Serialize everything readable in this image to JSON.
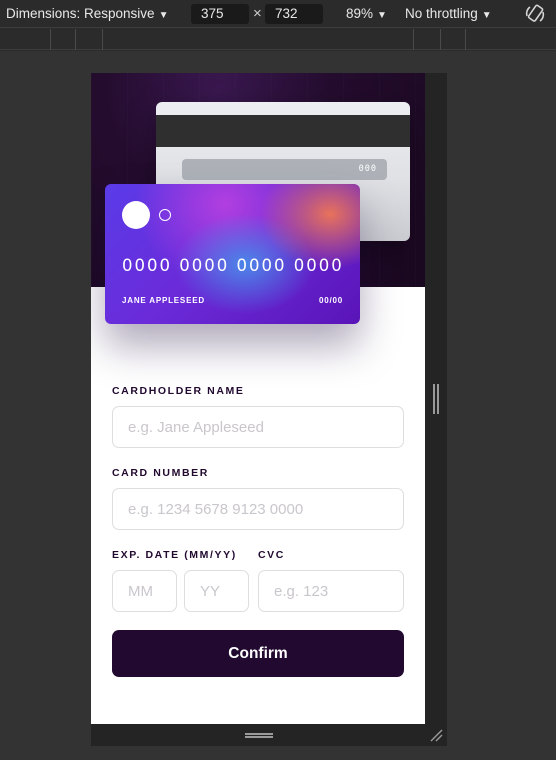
{
  "devtools": {
    "dimensions_label": "Dimensions: Responsive",
    "width_value": "375",
    "height_value": "732",
    "times_symbol": "×",
    "zoom_label": "89%",
    "throttling_label": "No throttling",
    "caret_glyph": "▼",
    "icons": {
      "dropdown": "chevron-down-icon",
      "rotate": "rotate-icon",
      "resize": "resize-grip-icon"
    }
  },
  "card_back": {
    "cvc": "000"
  },
  "card_front": {
    "number": "0000 0000 0000 0000",
    "name": "JANE APPLESEED",
    "expiry": "00/00"
  },
  "form": {
    "cardholder_label": "CARDHOLDER NAME",
    "cardholder_placeholder": "e.g. Jane Appleseed",
    "number_label": "CARD NUMBER",
    "number_placeholder": "e.g. 1234 5678 9123 0000",
    "exp_label": "EXP. DATE (MM/YY)",
    "month_placeholder": "MM",
    "year_placeholder": "YY",
    "cvc_label": "CVC",
    "cvc_placeholder": "e.g. 123",
    "confirm_label": "Confirm"
  },
  "colors": {
    "dark_violet": "#21092f",
    "input_border": "#dedddf",
    "placeholder": "#c9c6cc",
    "devtools_bg": "#2b2b2b"
  }
}
